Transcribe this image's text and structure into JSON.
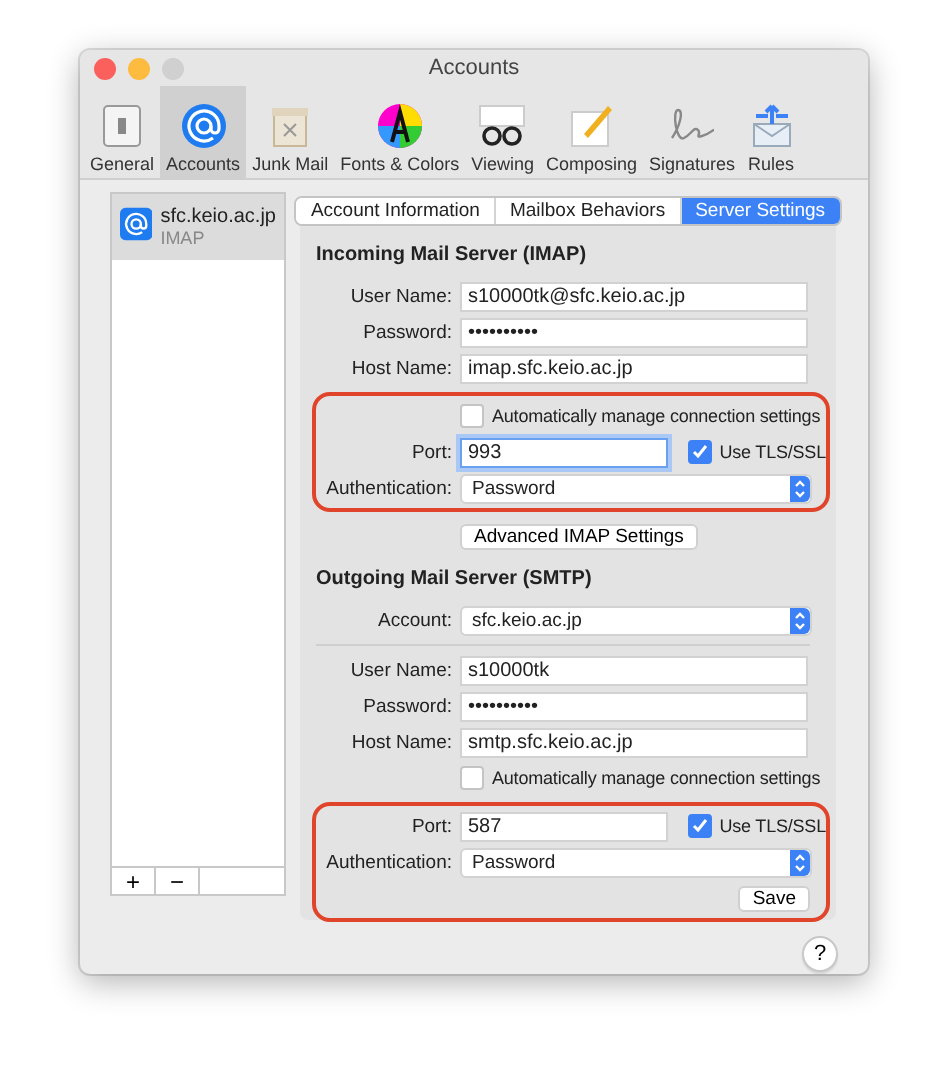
{
  "window": {
    "title": "Accounts"
  },
  "toolbar": [
    {
      "label": "General",
      "selected": false
    },
    {
      "label": "Accounts",
      "selected": true
    },
    {
      "label": "Junk Mail",
      "selected": false
    },
    {
      "label": "Fonts & Colors",
      "selected": false
    },
    {
      "label": "Viewing",
      "selected": false
    },
    {
      "label": "Composing",
      "selected": false
    },
    {
      "label": "Signatures",
      "selected": false
    },
    {
      "label": "Rules",
      "selected": false
    }
  ],
  "accounts": [
    {
      "name": "sfc.keio.ac.jp",
      "type": "IMAP",
      "selected": true
    }
  ],
  "account_buttons": [
    "+",
    "−"
  ],
  "tabs": [
    {
      "label": "Account Information",
      "selected": false
    },
    {
      "label": "Mailbox Behaviors",
      "selected": false
    },
    {
      "label": "Server Settings",
      "selected": true
    }
  ],
  "sections": [
    {
      "title": "Incoming Mail Server (IMAP)",
      "groups": [
        {
          "rows": [
            {
              "kind": "text",
              "label": "User Name:",
              "value": "s10000tk@sfc.keio.ac.jp"
            },
            {
              "kind": "text",
              "label": "Password:",
              "value": "••••••••••"
            },
            {
              "kind": "text",
              "label": "Host Name:",
              "value": "imap.sfc.keio.ac.jp"
            }
          ]
        },
        {
          "highlighted": true,
          "rows": [
            {
              "kind": "checkbox",
              "label": "Automatically manage connection settings",
              "checked": false
            },
            {
              "kind": "port",
              "label": "Port:",
              "value": "993",
              "focused": true,
              "option": "Use TLS/SSL",
              "checked": true
            },
            {
              "kind": "select",
              "label": "Authentication:",
              "value": "Password"
            }
          ]
        },
        {
          "rows": [
            {
              "kind": "button",
              "label": "Advanced IMAP Settings"
            }
          ]
        }
      ]
    },
    {
      "title": "Outgoing Mail Server (SMTP)",
      "groups": [
        {
          "rows": [
            {
              "kind": "select",
              "label": "Account:",
              "value": "sfc.keio.ac.jp"
            },
            {
              "kind": "divider"
            },
            {
              "kind": "text",
              "label": "User Name:",
              "value": "s10000tk"
            },
            {
              "kind": "text",
              "label": "Password:",
              "value": "••••••••••"
            },
            {
              "kind": "text",
              "label": "Host Name:",
              "value": "smtp.sfc.keio.ac.jp"
            },
            {
              "kind": "checkbox",
              "label": "Automatically manage connection settings",
              "checked": false
            }
          ]
        },
        {
          "highlighted": true,
          "rows": [
            {
              "kind": "port",
              "label": "Port:",
              "value": "587",
              "focused": false,
              "option": "Use TLS/SSL",
              "checked": true
            },
            {
              "kind": "select",
              "label": "Authentication:",
              "value": "Password"
            },
            {
              "kind": "save",
              "label": "Save"
            }
          ]
        }
      ]
    }
  ],
  "help": "?"
}
